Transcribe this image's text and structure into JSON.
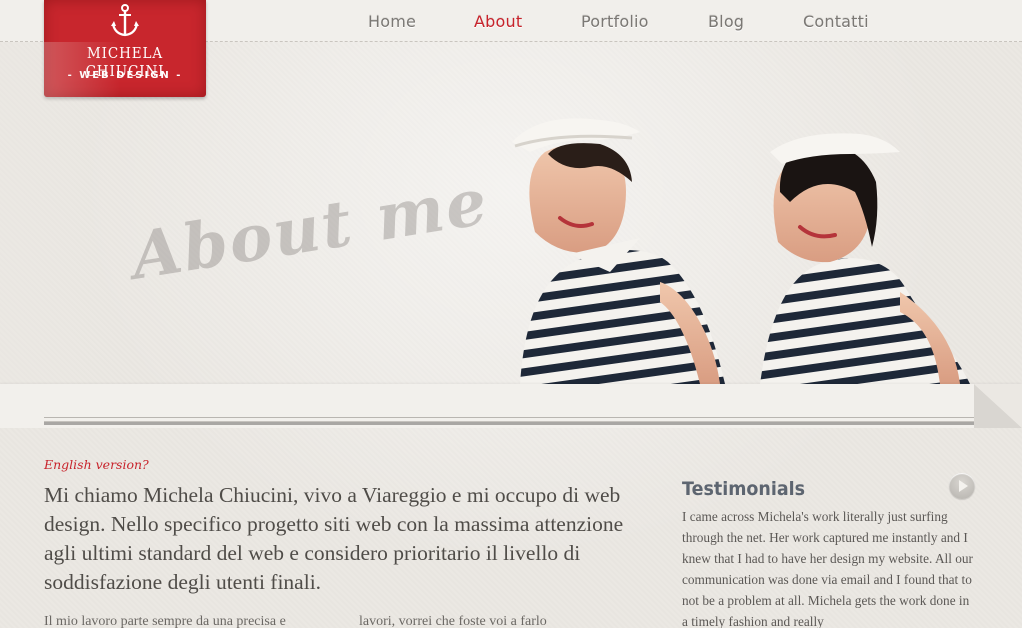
{
  "brand": {
    "name": "MICHELA CHIUCINI",
    "tagline": "- WEB DESIGN -",
    "color": "#c8262d"
  },
  "nav": {
    "items": [
      {
        "label": "Home",
        "active": false
      },
      {
        "label": "About",
        "active": true
      },
      {
        "label": "Portfolio",
        "active": false
      },
      {
        "label": "Blog",
        "active": false
      },
      {
        "label": "Contatti",
        "active": false
      }
    ],
    "active_color": "#c8232b"
  },
  "hero": {
    "title": "About me"
  },
  "content": {
    "english_link": "English version?",
    "intro": "Mi chiamo Michela Chiucini, vivo a Viareggio e mi occupo di web design. Nello specifico progetto siti web con la massima attenzione agli ultimi standard del web e considero prioritario il livello di soddisfazione degli utenti finali.",
    "body_col1": "Il mio lavoro parte sempre da una precisa e",
    "body_col2": "lavori, vorrei che foste voi a farlo"
  },
  "testimonials": {
    "title": "Testimonials",
    "text": "I came across Michela's work literally just surfing through the net. Her work captured me instantly and I knew that I had to have her design my website. All our communication was done via email and I found that to not be a problem at all. Michela gets the work done in a timely fashion and really"
  },
  "icons": [
    "anchor-icon",
    "play-icon"
  ]
}
